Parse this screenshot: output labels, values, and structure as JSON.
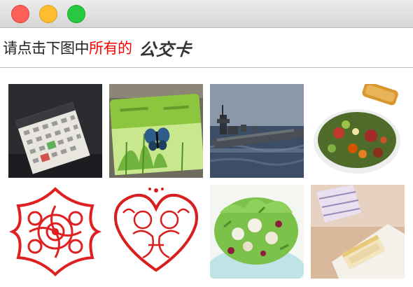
{
  "window": {
    "buttons": {
      "close": "close",
      "minimize": "minimize",
      "maximize": "maximize"
    }
  },
  "prompt": {
    "part1": "请点击下图中",
    "part2_red": "所有的",
    "target_word": "公交卡",
    "colors": {
      "text": "#222222",
      "highlight": "#ff0000"
    }
  },
  "tiles": [
    {
      "name": "calendar-photo"
    },
    {
      "name": "transit-card-photo"
    },
    {
      "name": "warship-photo"
    },
    {
      "name": "salad-photo"
    },
    {
      "name": "paper-cut-photo"
    },
    {
      "name": "paper-cut-heart-photo"
    },
    {
      "name": "salad-bowl-photo"
    },
    {
      "name": "cake-photo"
    }
  ]
}
